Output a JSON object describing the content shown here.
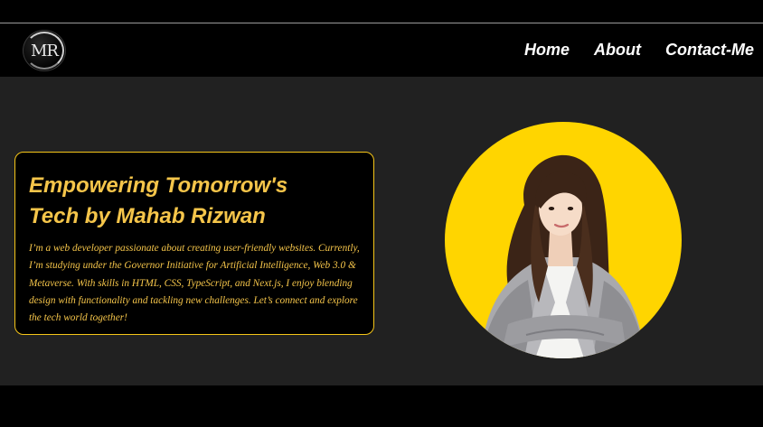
{
  "header": {
    "logo_text": "MR",
    "nav": [
      {
        "label": "Home"
      },
      {
        "label": "About"
      },
      {
        "label": "Contact-Me"
      }
    ]
  },
  "hero": {
    "headline_line1": "Empowering Tomorrow's",
    "headline_line2": "Tech by Mahab Rizwan",
    "bio": "I’m a web developer passionate about creating user-friendly websites. Currently, I’m studying under the Governor Initiative for Artificial Intelligence, Web 3.0 & Metaverse. With skills in HTML, CSS, TypeScript, and Next.js, I enjoy blending design with functionality and tackling new challenges. Let’s connect and explore the tech world together!",
    "portrait_icon": "profile-photo"
  },
  "colors": {
    "accent": "#f5c518",
    "headline_text": "#f5c54a",
    "portrait_bg": "#ffd500",
    "hero_bg": "#212121",
    "nav_bg": "#000000"
  }
}
